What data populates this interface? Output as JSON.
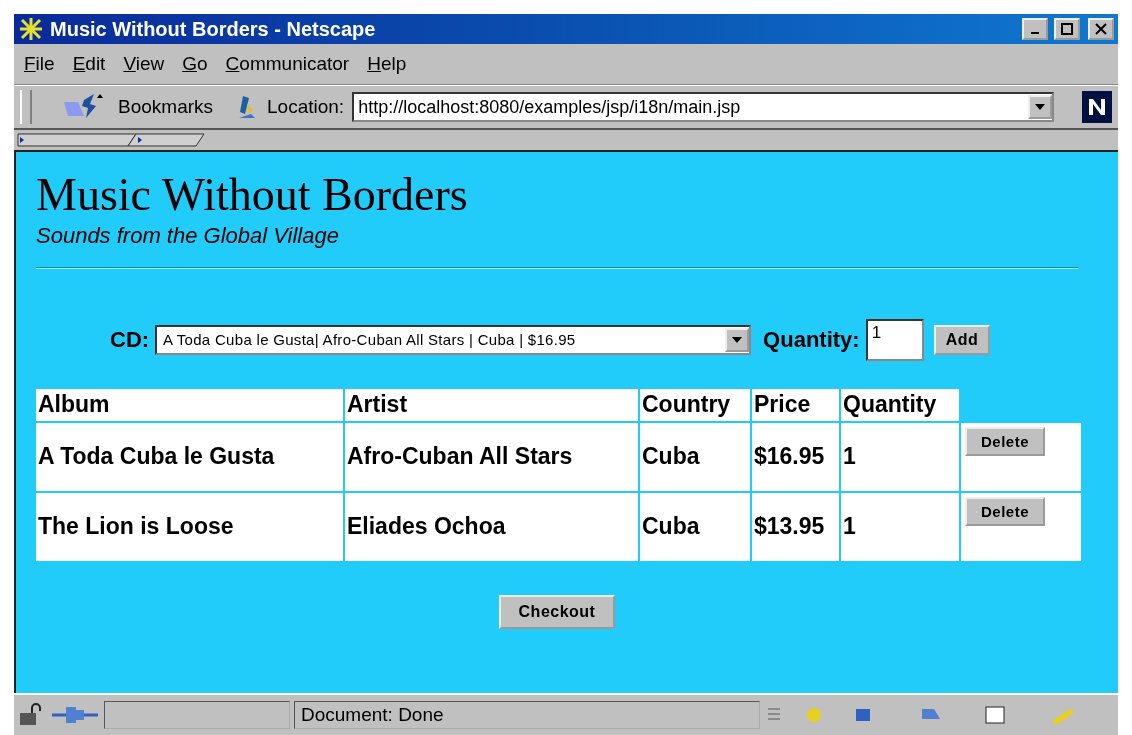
{
  "window": {
    "title": "Music Without Borders - Netscape"
  },
  "menu": [
    "File",
    "Edit",
    "View",
    "Go",
    "Communicator",
    "Help"
  ],
  "toolbar": {
    "bookmarks": "Bookmarks",
    "location_label": "Location:",
    "url": "http://localhost:8080/examples/jsp/i18n/main.jsp"
  },
  "page": {
    "heading": "Music Without Borders",
    "subtitle": "Sounds from the Global Village",
    "form": {
      "cd_label": "CD:",
      "cd_value": "A Toda Cuba le Gusta| Afro-Cuban All Stars | Cuba | $16.95",
      "quantity_label": "Quantity:",
      "quantity_value": "1",
      "add_button": "Add"
    },
    "table": {
      "columns": [
        "Album",
        "Artist",
        "Country",
        "Price",
        "Quantity"
      ],
      "rows": [
        {
          "album": "A Toda Cuba le Gusta",
          "artist": "Afro-Cuban All Stars",
          "country": "Cuba",
          "price": "$16.95",
          "quantity": "1",
          "action": "Delete"
        },
        {
          "album": "The Lion is Loose",
          "artist": "Eliades Ochoa",
          "country": "Cuba",
          "price": "$13.95",
          "quantity": "1",
          "action": "Delete"
        }
      ]
    },
    "checkout_button": "Checkout"
  },
  "status_bar": {
    "text": "Document: Done"
  }
}
